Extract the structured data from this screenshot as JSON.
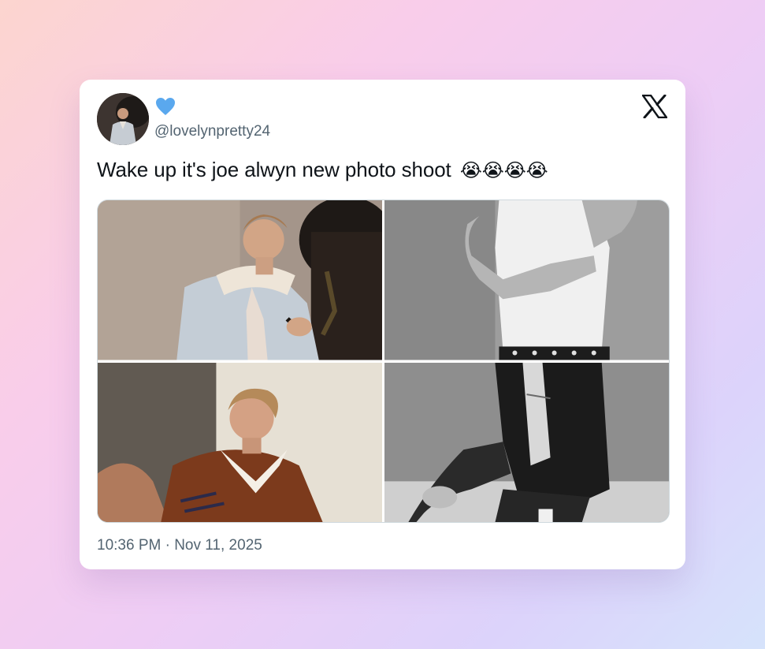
{
  "tweet": {
    "handle": "@lovelynpretty24",
    "text": "Wake up it's joe alwyn new photo shoot",
    "emojis": "😭😭😭😭",
    "timestamp": "10:36 PM · Nov 11, 2025"
  },
  "icons": {
    "verified": "blue-heart-icon",
    "brand": "x-logo-icon"
  },
  "colors": {
    "heart": "#5aa8ee",
    "handle": "#536471",
    "text": "#0f1419"
  },
  "photos": [
    {
      "name": "photo-denim-jacket-with-dog"
    },
    {
      "name": "photo-white-tank-top"
    },
    {
      "name": "photo-brown-polo-sweater"
    },
    {
      "name": "photo-black-leather-jacket"
    }
  ]
}
